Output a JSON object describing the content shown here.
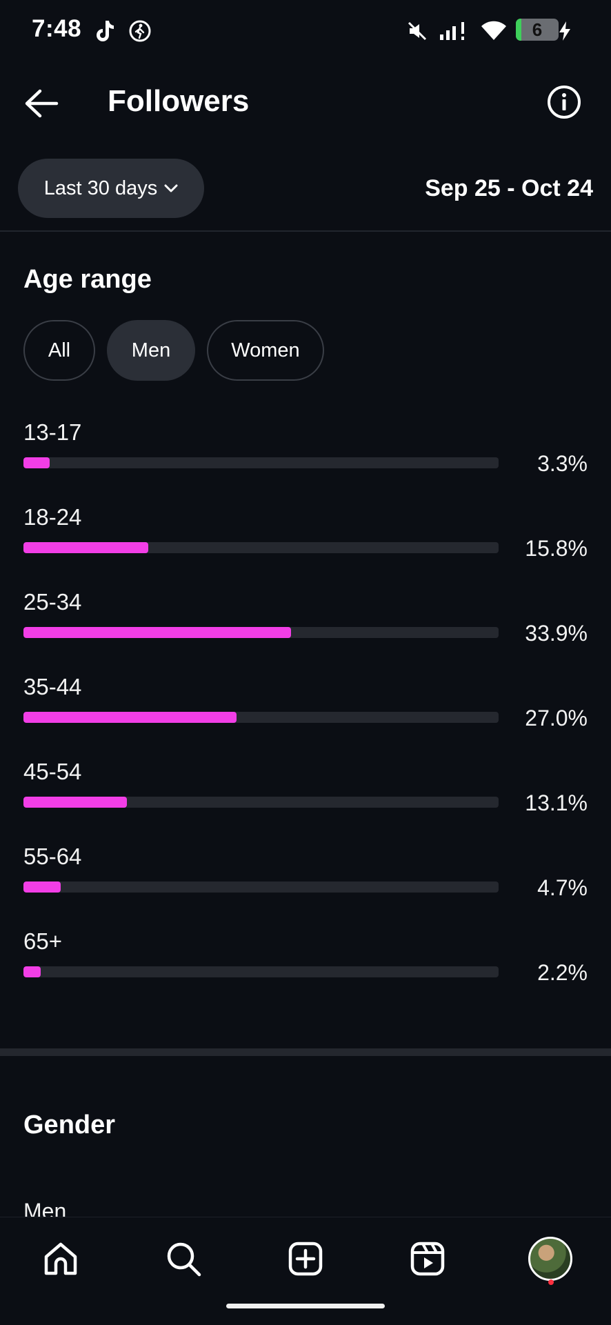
{
  "status_bar": {
    "time": "7:48",
    "battery": "6",
    "icons": [
      "tiktok-icon",
      "activity-icon",
      "mute-icon",
      "signal-icon",
      "wifi-icon",
      "battery-icon",
      "charging-icon"
    ]
  },
  "header": {
    "title": "Followers",
    "back_icon": "arrow-left-icon",
    "info_icon": "info-icon"
  },
  "filter": {
    "range_label": "Last 30 days",
    "date_range": "Sep 25 - Oct 24"
  },
  "age_section": {
    "title": "Age range",
    "chips": [
      {
        "label": "All",
        "active": false
      },
      {
        "label": "Men",
        "active": true
      },
      {
        "label": "Women",
        "active": false
      }
    ],
    "bar_color": "#f23ee6",
    "rows": [
      {
        "label": "13-17",
        "percent": "3.3%",
        "value": 3.3
      },
      {
        "label": "18-24",
        "percent": "15.8%",
        "value": 15.8
      },
      {
        "label": "25-34",
        "percent": "33.9%",
        "value": 33.9
      },
      {
        "label": "35-44",
        "percent": "27.0%",
        "value": 27.0
      },
      {
        "label": "45-54",
        "percent": "13.1%",
        "value": 13.1
      },
      {
        "label": "55-64",
        "percent": "4.7%",
        "value": 4.7
      },
      {
        "label": "65+",
        "percent": "2.2%",
        "value": 2.2
      }
    ]
  },
  "gender_section": {
    "title": "Gender",
    "first_row_label": "Men"
  },
  "bottom_nav": {
    "items": [
      "home-icon",
      "search-icon",
      "create-icon",
      "reels-icon",
      "profile-avatar"
    ]
  }
}
